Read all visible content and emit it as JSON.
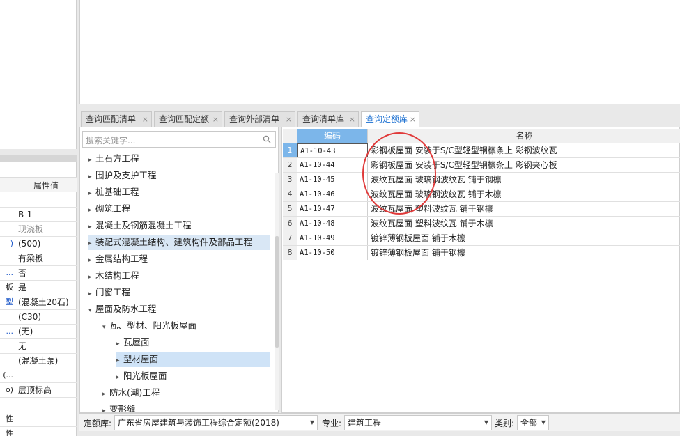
{
  "props": {
    "header": "属性值",
    "rows": [
      {
        "key": "",
        "value": ""
      },
      {
        "key": "",
        "value": "B-1"
      },
      {
        "key": "",
        "value": "现浇板",
        "gray": true
      },
      {
        "key": ")",
        "value": "(500)",
        "blue": true
      },
      {
        "key": "",
        "value": "有梁板"
      },
      {
        "key": "...",
        "value": "否",
        "blue": true
      },
      {
        "key": "板",
        "value": "是"
      },
      {
        "key": "型",
        "value": "(混凝土20石)",
        "blue": true
      },
      {
        "key": "",
        "value": "(C30)"
      },
      {
        "key": "...",
        "value": "(无)",
        "blue": true
      },
      {
        "key": "",
        "value": "无"
      },
      {
        "key": "",
        "value": "(混凝土泵)"
      },
      {
        "key": "(...",
        "value": ""
      },
      {
        "key": "o)",
        "value": "层顶标高"
      },
      {
        "key": "",
        "value": ""
      },
      {
        "key": "性",
        "value": ""
      },
      {
        "key": "性",
        "value": ""
      }
    ]
  },
  "tabs": [
    {
      "label": "查询匹配清单",
      "close": "×"
    },
    {
      "label": "查询匹配定额",
      "close": "×"
    },
    {
      "label": "查询外部清单",
      "close": "×"
    },
    {
      "label": "查询清单库",
      "close": "×"
    },
    {
      "label": "查询定额库",
      "close": "×",
      "active": true
    }
  ],
  "search": {
    "placeholder": "搜索关键字..."
  },
  "tree": [
    {
      "label": "土石方工程",
      "arrow": "▸",
      "level": 0
    },
    {
      "label": "围护及支护工程",
      "arrow": "▸",
      "level": 0
    },
    {
      "label": "桩基础工程",
      "arrow": "▸",
      "level": 0
    },
    {
      "label": "砌筑工程",
      "arrow": "▸",
      "level": 0
    },
    {
      "label": "混凝土及钢筋混凝土工程",
      "arrow": "▸",
      "level": 0
    },
    {
      "label": "装配式混凝土结构、建筑构件及部品工程",
      "arrow": "▸",
      "level": 0,
      "hl": "sel2"
    },
    {
      "label": "金属结构工程",
      "arrow": "▸",
      "level": 0
    },
    {
      "label": "木结构工程",
      "arrow": "▸",
      "level": 0
    },
    {
      "label": "门窗工程",
      "arrow": "▸",
      "level": 0
    },
    {
      "label": "屋面及防水工程",
      "arrow": "▾",
      "level": 0
    },
    {
      "label": "瓦、型材、阳光板屋面",
      "arrow": "▾",
      "level": 1
    },
    {
      "label": "瓦屋面",
      "arrow": "▸",
      "level": 2
    },
    {
      "label": "型材屋面",
      "arrow": "▸",
      "level": 2,
      "hl": "sel"
    },
    {
      "label": "阳光板屋面",
      "arrow": "▸",
      "level": 2
    },
    {
      "label": "防水(潮)工程",
      "arrow": "▸",
      "level": 1
    },
    {
      "label": "变形缝",
      "arrow": "▸",
      "level": 1
    }
  ],
  "grid": {
    "col_code": "编码",
    "col_name": "名称",
    "rows": [
      {
        "n": "1",
        "code": "A1-10-43",
        "name": "彩钢板屋面 安装于S/C型轻型钢檩条上 彩钢波纹瓦"
      },
      {
        "n": "2",
        "code": "A1-10-44",
        "name": "彩钢板屋面 安装于S/C型轻型钢檩条上 彩钢夹心板"
      },
      {
        "n": "3",
        "code": "A1-10-45",
        "name": "波纹瓦屋面 玻璃钢波纹瓦 铺于钢檩"
      },
      {
        "n": "4",
        "code": "A1-10-46",
        "name": "波纹瓦屋面 玻璃钢波纹瓦 铺于木檩"
      },
      {
        "n": "5",
        "code": "A1-10-47",
        "name": "波纹瓦屋面 塑料波纹瓦 铺于钢檩"
      },
      {
        "n": "6",
        "code": "A1-10-48",
        "name": "波纹瓦屋面 塑料波纹瓦 铺于木檩"
      },
      {
        "n": "7",
        "code": "A1-10-49",
        "name": "镀锌薄钢板屋面 铺于木檩"
      },
      {
        "n": "8",
        "code": "A1-10-50",
        "name": "镀锌薄钢板屋面 铺于钢檩"
      }
    ]
  },
  "filters": {
    "quota_label": "定额库:",
    "quota_value": "广东省房屋建筑与装饰工程综合定额(2018)",
    "spec_label": "专业:",
    "spec_value": "建筑工程",
    "cat_label": "类别:",
    "cat_value": "全部",
    "caret": "▼"
  },
  "colors": {
    "accent": "#1a6fd1",
    "header_blue": "#7cb6ea",
    "annotation": "#e03a3a",
    "selection": "#cfe3f7"
  }
}
